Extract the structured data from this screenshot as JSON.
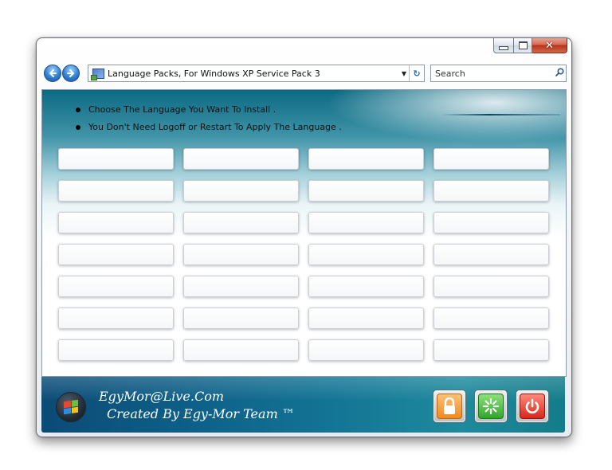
{
  "window": {
    "caption_buttons": {
      "minimize_icon": "minimize-icon",
      "maximize_icon": "maximize-icon",
      "close_glyph": "✕"
    }
  },
  "toolbar": {
    "back_icon": "arrow-left-icon",
    "forward_icon": "arrow-right-icon",
    "address_text": "Language Packs, For Windows XP Service Pack 3",
    "search_placeholder": "Search"
  },
  "content": {
    "instructions": [
      "Choose The Language You Want To Install .",
      "You Don't Need Logoff or Restart To Apply The Language ."
    ],
    "language_grid": {
      "rows": 7,
      "columns": 4,
      "labels": []
    }
  },
  "footer": {
    "email": "EgyMor@Live.Com",
    "credit": "Created By Egy-Mor Team ™",
    "actions": [
      "lock-icon",
      "reload-icon",
      "power-icon"
    ]
  },
  "colors": {
    "header_teal": "#0b6a83",
    "footer_blue": "#0b4b76",
    "footer_teal": "#1e8a9d",
    "lock_orange": "#f08a1c",
    "reload_green": "#2fa52b",
    "power_red": "#d8261c"
  }
}
